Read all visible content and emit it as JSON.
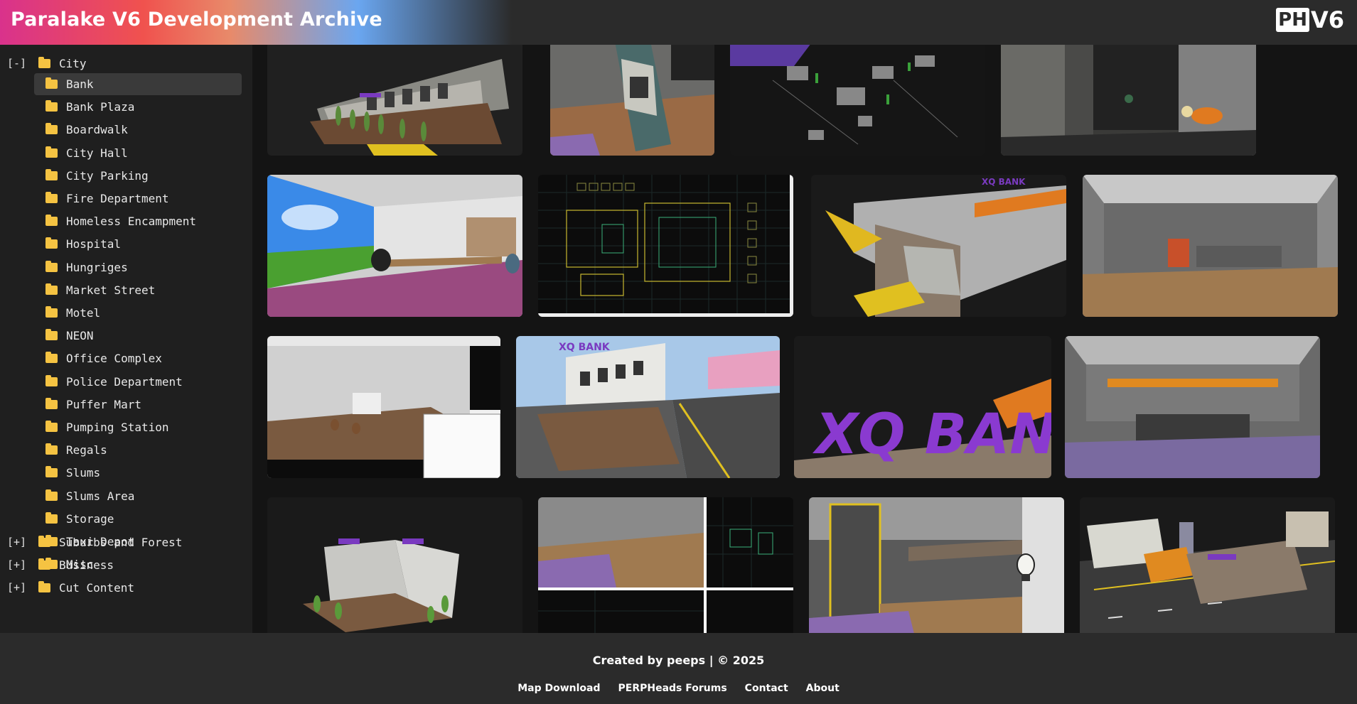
{
  "header": {
    "title": "Paralake V6 Development Archive",
    "logo_ph": "PH",
    "logo_v6": "V6"
  },
  "sidebar": {
    "root": {
      "toggle": "[-]",
      "label": "City"
    },
    "children": [
      "Bank",
      "Bank Plaza",
      "Boardwalk",
      "City Hall",
      "City Parking",
      "Fire Department",
      "Homeless Encampment",
      "Hospital",
      "Hungriges",
      "Market Street",
      "Motel",
      "NEON",
      "Office Complex",
      "Police Department",
      "Puffer Mart",
      "Pumping Station",
      "Regals",
      "Slums",
      "Slums Area",
      "Storage",
      "Taxi Depot",
      "Misc"
    ],
    "selected": "Bank",
    "collapsed": [
      {
        "toggle": "[+]",
        "label": "Suburbs and Forest"
      },
      {
        "toggle": "[+]",
        "label": "Business"
      },
      {
        "toggle": "[+]",
        "label": "Cut Content"
      }
    ]
  },
  "gallery": {
    "images": [
      "bank-exterior-street",
      "atm-closeup",
      "interior-wireframe-props",
      "dark-room-lamp",
      "office-desk-xp-wallpaper",
      "floorplan-wireframe",
      "glass-entrance-top",
      "grey-interior-hall",
      "hammer-editor-screenshot",
      "xq-bank-street-view",
      "xq-bank-sign",
      "orange-counter-interior",
      "bank-building-isometric",
      "editor-four-viewports",
      "lobby-lightbulb",
      "street-overview"
    ],
    "texts": {
      "sign_top": "XQ BANK",
      "sign_large": "XQ BANK",
      "sign_small": "XQ BANK"
    }
  },
  "footer": {
    "credit": "Created by peeps | © 2025",
    "links": [
      "Map Download",
      "PERPHeads Forums",
      "Contact",
      "About"
    ]
  },
  "colors": {
    "header_bg": "#2b2b2b",
    "sidebar_bg": "#1f1f1f",
    "main_bg": "#141414",
    "folder": "#f5c342",
    "selected_row": "#3a3a3a"
  }
}
